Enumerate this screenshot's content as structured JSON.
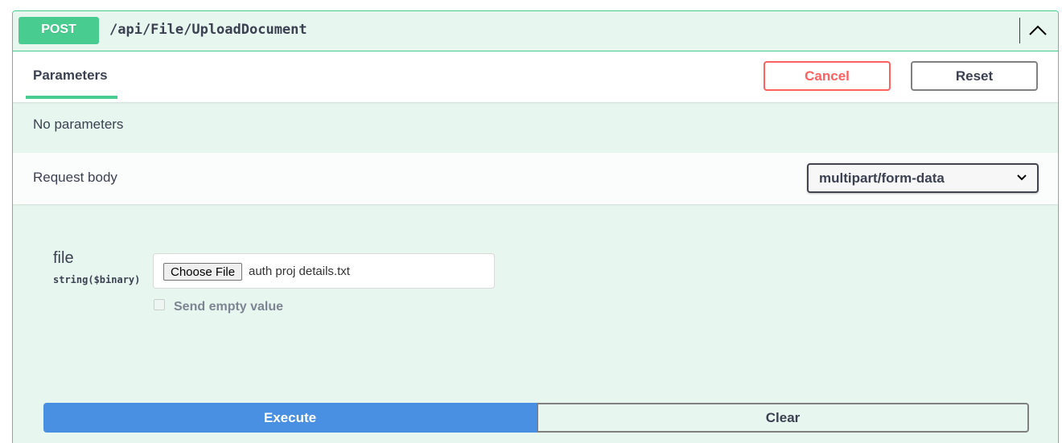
{
  "operation": {
    "method": "POST",
    "path": "/api/File/UploadDocument"
  },
  "tabs": {
    "parameters_label": "Parameters",
    "cancel_label": "Cancel",
    "reset_label": "Reset"
  },
  "parameters": {
    "empty_text": "No parameters"
  },
  "request_body": {
    "label": "Request body",
    "content_type": "multipart/form-data",
    "fields": [
      {
        "name": "file",
        "type": "string($binary)",
        "choose_label": "Choose File",
        "selected_file": "auth proj details.txt",
        "send_empty_label": "Send empty value",
        "send_empty_checked": false
      }
    ]
  },
  "actions": {
    "execute_label": "Execute",
    "clear_label": "Clear"
  },
  "colors": {
    "post_green": "#49cc90",
    "execute_blue": "#4990e2",
    "cancel_red": "#ff6060"
  },
  "icons": {
    "collapse": "chevron-up-icon",
    "select": "chevron-down-icon"
  }
}
